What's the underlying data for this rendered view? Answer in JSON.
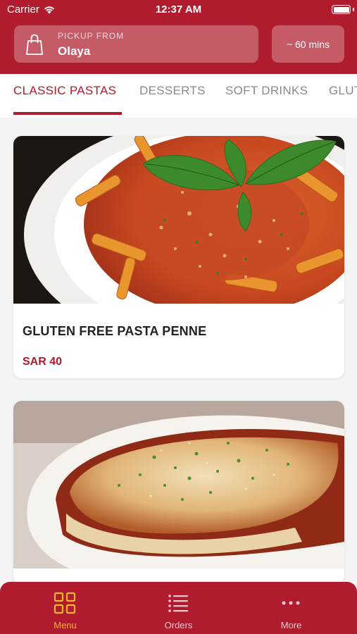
{
  "status_bar": {
    "carrier": "Carrier",
    "time": "12:37 AM"
  },
  "header": {
    "pickup_label": "PICKUP FROM",
    "pickup_location": "Olaya",
    "eta": "~ 60 mins"
  },
  "tabs": [
    {
      "label": "CLASSIC PASTAS",
      "active": true
    },
    {
      "label": "DESSERTS",
      "active": false
    },
    {
      "label": "SOFT DRINKS",
      "active": false
    },
    {
      "label": "GLUT",
      "active": false
    }
  ],
  "products": [
    {
      "name": "GLUTEN FREE PASTA PENNE",
      "price": "SAR 40"
    },
    {
      "name": "",
      "price": ""
    }
  ],
  "bottom_nav": [
    {
      "label": "Menu",
      "icon": "grid-icon",
      "active": true
    },
    {
      "label": "Orders",
      "icon": "list-icon",
      "active": false
    },
    {
      "label": "More",
      "icon": "more-icon",
      "active": false
    }
  ],
  "colors": {
    "brand": "#b01c2e",
    "active_nav": "#f2b52c",
    "tab_inactive": "#8a8a8a"
  }
}
